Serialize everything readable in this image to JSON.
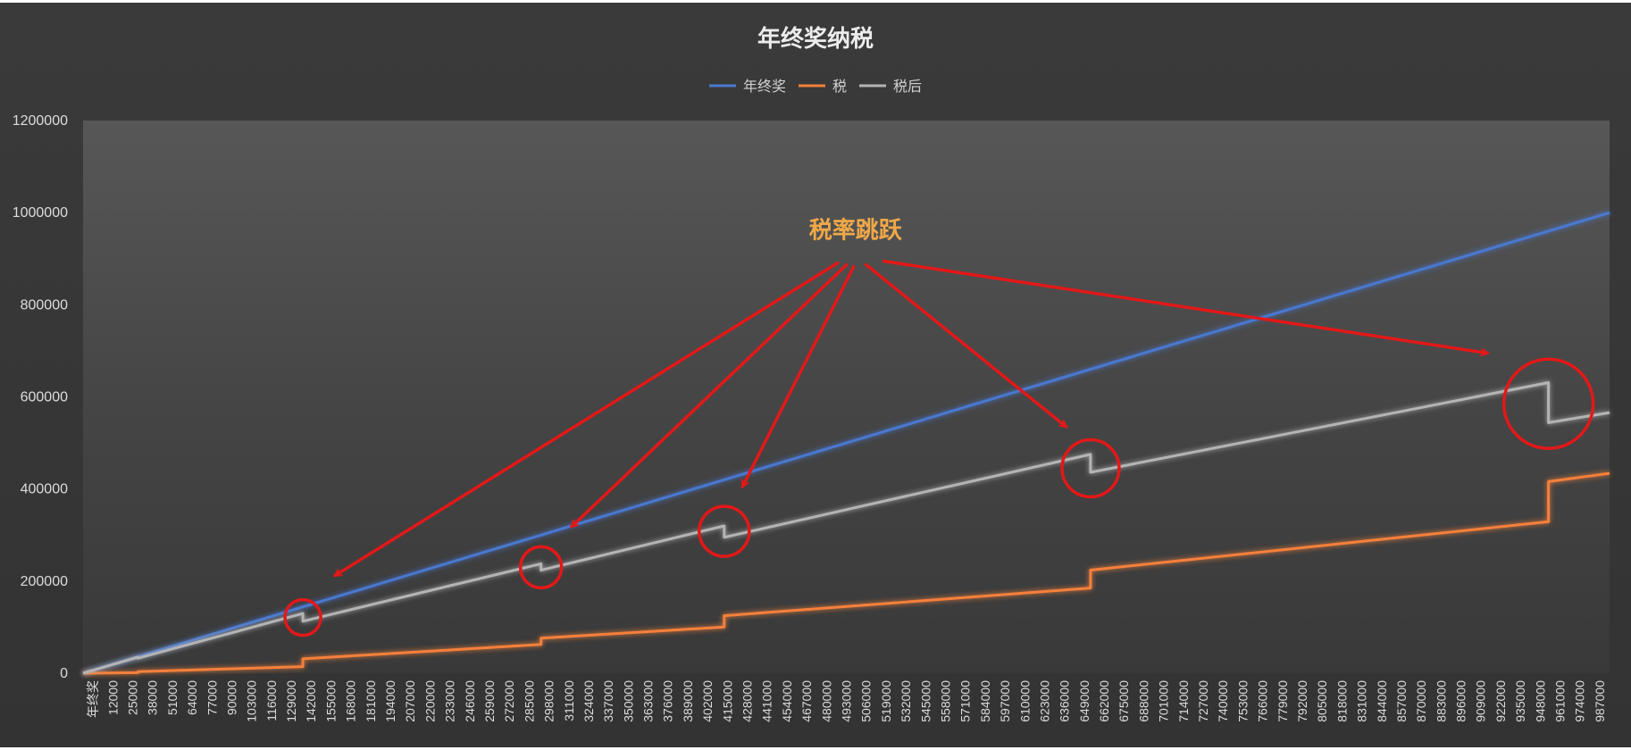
{
  "chart_data": {
    "type": "line",
    "title": "年终奖纳税",
    "legend_position": "top-center",
    "grid": false,
    "ylim": [
      0,
      1200000
    ],
    "yticks": [
      0,
      200000,
      400000,
      600000,
      800000,
      1000000,
      1200000
    ],
    "xlabel": "",
    "ylabel": "",
    "x_categories": [
      "年终奖",
      "12000",
      "25000",
      "38000",
      "51000",
      "64000",
      "77000",
      "90000",
      "103000",
      "116000",
      "129000",
      "142000",
      "155000",
      "168000",
      "181000",
      "194000",
      "207000",
      "220000",
      "233000",
      "246000",
      "259000",
      "272000",
      "285000",
      "298000",
      "311000",
      "324000",
      "337000",
      "350000",
      "363000",
      "376000",
      "389000",
      "402000",
      "415000",
      "428000",
      "441000",
      "454000",
      "467000",
      "480000",
      "493000",
      "506000",
      "519000",
      "532000",
      "545000",
      "558000",
      "571000",
      "584000",
      "597000",
      "610000",
      "623000",
      "636000",
      "649000",
      "662000",
      "675000",
      "688000",
      "701000",
      "714000",
      "727000",
      "740000",
      "753000",
      "766000",
      "779000",
      "792000",
      "805000",
      "818000",
      "831000",
      "844000",
      "857000",
      "870000",
      "883000",
      "896000",
      "909000",
      "922000",
      "935000",
      "948000",
      "961000",
      "974000",
      "987000"
    ],
    "x_range": [
      0,
      1000000
    ],
    "series": [
      {
        "name": "年终奖",
        "color": "#4a78d0",
        "x": [
          0,
          1000000
        ],
        "values": [
          0,
          1000000
        ]
      },
      {
        "name": "税",
        "color": "#f5803a",
        "x": [
          0,
          36000,
          36001,
          144000,
          144001,
          300000,
          300001,
          420000,
          420001,
          660000,
          660001,
          960000,
          960001,
          1000000
        ],
        "values": [
          0,
          1080,
          3490,
          14290,
          31190,
          62390,
          76190,
          100190,
          124910,
          184910,
          223910,
          328910,
          416090,
          434090
        ]
      },
      {
        "name": "税后",
        "color": "#b4b4b4",
        "x": [
          0,
          36000,
          36001,
          144000,
          144001,
          300000,
          300001,
          420000,
          420001,
          660000,
          660001,
          960000,
          960001,
          1000000
        ],
        "values": [
          0,
          34920,
          32511,
          129710,
          112811,
          237610,
          223811,
          319810,
          295091,
          475091,
          436091,
          631091,
          543911,
          565911
        ]
      }
    ],
    "annotation": {
      "text": "税率跳跃",
      "color": "#f0a848",
      "arrow_color": "#e31818",
      "circled_points": [
        {
          "x": 144000,
          "y": 121000
        },
        {
          "x": 300000,
          "y": 230000
        },
        {
          "x": 420000,
          "y": 308000
        },
        {
          "x": 660000,
          "y": 445000
        },
        {
          "x": 960000,
          "y": 585000
        }
      ]
    }
  }
}
